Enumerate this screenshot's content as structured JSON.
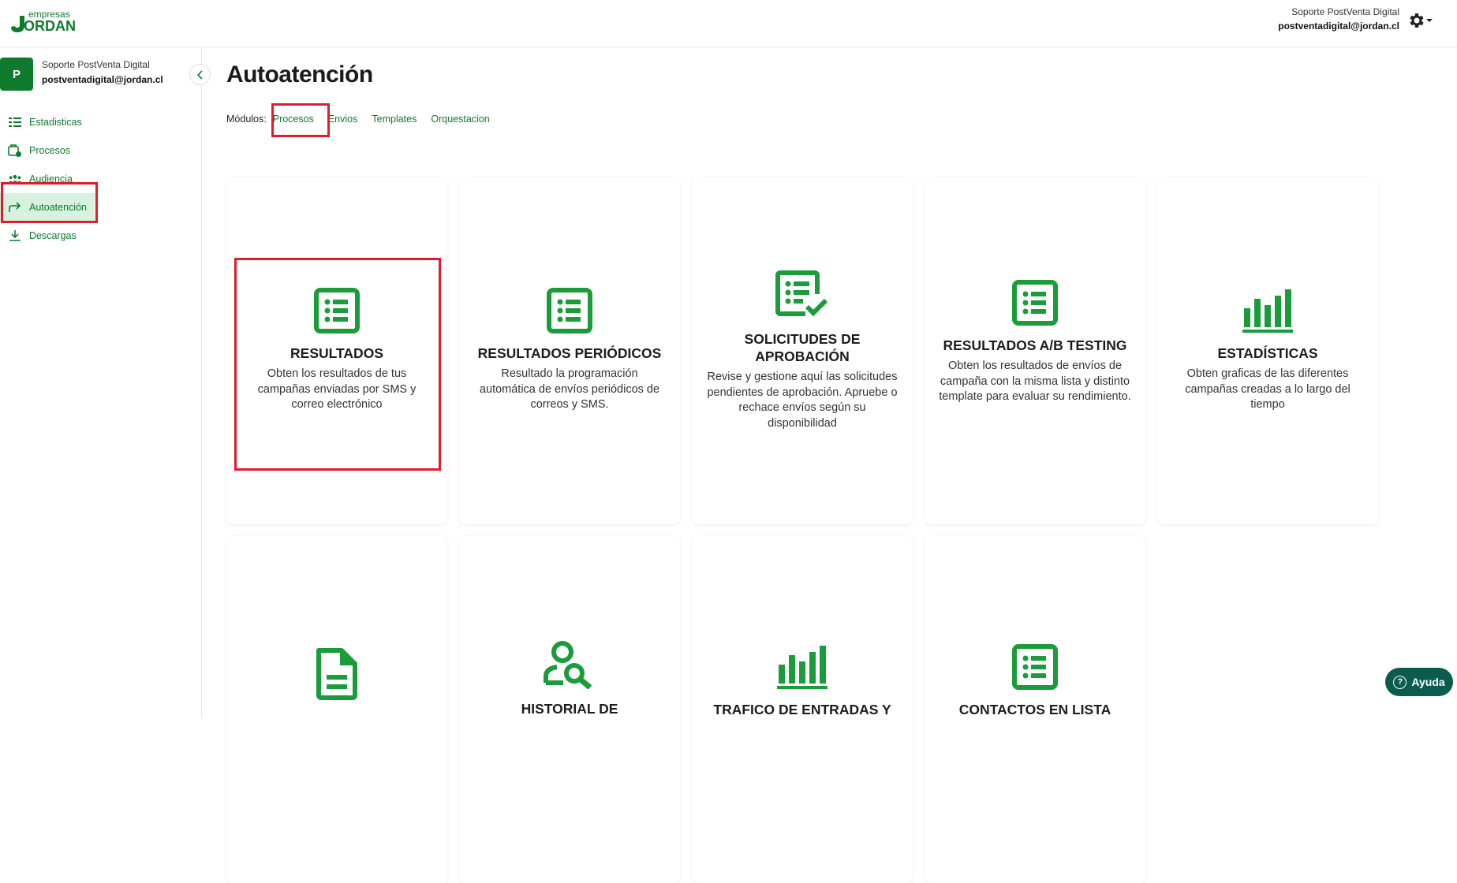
{
  "brand": {
    "logo_top": "empresas",
    "logo_bottom": "ORDAN",
    "accent": "#0f7a2c",
    "icon_green": "#1a9c3a"
  },
  "topbar": {
    "user_name": "Soporte PostVenta Digital",
    "user_email": "postventadigital@jordan.cl",
    "settings_icon": "gear-icon"
  },
  "sidebar": {
    "avatar_letter": "P",
    "user_name": "Soporte PostVenta Digital",
    "user_email": "postventadigital@jordan.cl",
    "items": [
      {
        "label": "Estadisticas",
        "icon": "stats-list-icon"
      },
      {
        "label": "Procesos",
        "icon": "process-icon"
      },
      {
        "label": "Audiencia",
        "icon": "audience-icon"
      },
      {
        "label": "Autoatención",
        "icon": "share-arrow-icon",
        "active": true
      },
      {
        "label": "Descargas",
        "icon": "download-icon"
      }
    ]
  },
  "main": {
    "title": "Autoatención",
    "modules_label": "Módulos:",
    "modules": [
      "Procesos",
      "Envios",
      "Templates",
      "Orquestacion"
    ],
    "cards": [
      {
        "title": "RESULTADOS",
        "desc": "Obten los resultados de tus campañas enviadas por SMS y correo electrónico",
        "icon": "list-icon"
      },
      {
        "title": "RESULTADOS PERIÓDICOS",
        "desc": "Resultado la programación automática de envíos periódicos de correos y SMS.",
        "icon": "list-icon"
      },
      {
        "title": "SOLICITUDES DE APROBACIÓN",
        "desc": "Revise y gestione aquí las solicitudes pendientes de aprobación. Apruebe o rechace envíos según su disponibilidad",
        "icon": "list-check-icon"
      },
      {
        "title": "RESULTADOS A/B TESTING",
        "desc": "Obten los resultados de envíos de campaña con la misma lista y distinto template para evaluar su rendimiento.",
        "icon": "list-icon"
      },
      {
        "title": "ESTADÍSTICAS",
        "desc": "Obten graficas de las diferentes campañas creadas a lo largo del tiempo",
        "icon": "bar-chart-icon"
      },
      {
        "title": "",
        "desc": "",
        "icon": "document-icon"
      },
      {
        "title": "HISTORIAL DE",
        "desc": "",
        "icon": "user-search-icon"
      },
      {
        "title": "TRAFICO DE ENTRADAS Y",
        "desc": "",
        "icon": "bar-chart-icon"
      },
      {
        "title": "CONTACTOS EN LISTA",
        "desc": "",
        "icon": "list-icon"
      }
    ]
  },
  "help": {
    "label": "Ayuda"
  }
}
